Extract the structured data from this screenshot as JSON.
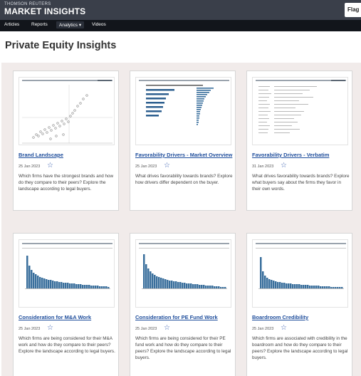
{
  "header": {
    "brand_small": "THOMSON REUTERS",
    "brand_big": "MARKET INSIGHTS",
    "right_button": "Flag"
  },
  "nav": {
    "items": [
      "Articles",
      "Reports",
      "Analytics ▾",
      "Videos"
    ],
    "active": "Analytics"
  },
  "page": {
    "title": "Private Equity Insights"
  },
  "icons": {
    "favorite": "star-outline-icon"
  },
  "colors": {
    "link": "#1f4e9c",
    "bars": "#3a6f9c",
    "nav_bg": "#12151b",
    "header_bg": "#3a3f4a",
    "grid_bg": "#f1ebea"
  },
  "cards": [
    {
      "title": "Brand Landscape",
      "date": "25 Jan 2023",
      "description": "Which firms have the strongest brands and how do they compare to their peers? Explore the landscape according to legal buyers."
    },
    {
      "title": "Favorability Drivers - Market Overview",
      "date": "25 Jan 2023",
      "description": "What drives favorability towards brands? Explore how drivers differ dependent on the buyer."
    },
    {
      "title": "Favorability Drivers - Verbatim",
      "date": "31 Jan 2023",
      "description": "What drives favorability towards brands? Explore what buyers say about the firms they favor in their own words."
    },
    {
      "title": "Consideration for M&A Work",
      "date": "25 Jan 2023",
      "description": "Which firms are being considered for their M&A work and how do they compare to their peers? Explore the landscape according to legal buyers."
    },
    {
      "title": "Consideration for PE Fund Work",
      "date": "25 Jan 2023",
      "description": "Which firms are being considered for their PE fund work and how do they compare to their peers? Explore the landscape according to legal buyers."
    },
    {
      "title": "Boardroom Credibility",
      "date": "25 Jan 2023",
      "description": "Which firms are associated with credibility in the boardroom and how do they compare to their peers? Explore the landscape according to legal buyers."
    }
  ]
}
